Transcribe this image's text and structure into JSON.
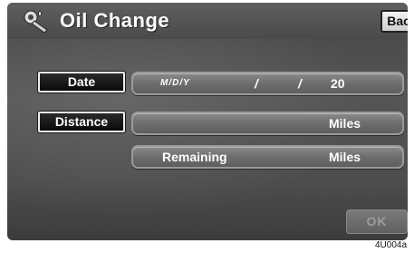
{
  "screen": {
    "title": "Oil Change",
    "title_icon": "oil-can-icon",
    "back_label": "Back"
  },
  "date_row": {
    "button_label": "Date",
    "format_label": "M/D/Y",
    "separator_1": "/",
    "separator_2": "/",
    "year_prefix": "20"
  },
  "distance_row": {
    "button_label": "Distance",
    "unit": "Miles"
  },
  "remaining_row": {
    "label": "Remaining",
    "unit": "Miles"
  },
  "ok_label": "OK",
  "image_code": "4U004a",
  "colors": {
    "button_dark": "#111111",
    "field": "#6e6e6e",
    "back_button": "#e0e0e0",
    "ok_disabled_text": "#9c9c9c"
  }
}
